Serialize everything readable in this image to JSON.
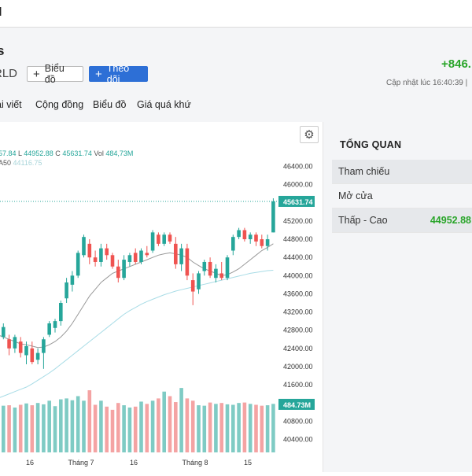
{
  "topbar": {
    "logo": "I"
  },
  "header": {
    "title": "s",
    "subtitle": "RLD",
    "chart_button": "Biểu đồ",
    "follow_button": "Theo dõi",
    "change": "+846.",
    "updated_label": "Cập nhật lúc",
    "updated_time": "16:40:39 |"
  },
  "tabs": [
    "ài viết",
    "Cộng đồng",
    "Biểu đồ",
    "Giá quá khứ"
  ],
  "sidebar": {
    "title": "TỔNG QUAN",
    "rows": [
      {
        "label": "Tham chiếu",
        "value": ""
      },
      {
        "label": "Mở cửa",
        "value": ""
      },
      {
        "label": "Thấp - Cao",
        "value": "44952.88"
      }
    ]
  },
  "chart": {
    "legend_o": "57.84",
    "legend_l_label": "L",
    "legend_l": "44952.88",
    "legend_c_label": "C",
    "legend_c": "45631.74",
    "legend_vol_label": "Vol",
    "legend_vol": "484,73M",
    "ma_label": "A50",
    "ma_value": "44116.75",
    "last_price_tag": "45631.74",
    "volume_tag": "484.73M",
    "price_ticks": [
      "46400.00",
      "46000.00",
      "45200.00",
      "44800.00",
      "44400.00",
      "44000.00",
      "43600.00",
      "43200.00",
      "42800.00",
      "42400.00",
      "42000.00",
      "41600.00",
      "41200.00",
      "40800.00",
      "40400.00"
    ],
    "x_labels": [
      "16",
      "Tháng 7",
      "16",
      "Tháng 8",
      "15"
    ],
    "colors": {
      "up": "#26a69a",
      "down": "#ef5350",
      "vol_up": "#7fcbc4",
      "vol_down": "#f4a3a3",
      "ma20": "#999999",
      "ma50": "#a8dce6"
    }
  },
  "chart_data": {
    "type": "candlestick",
    "ylim": [
      40200,
      46600
    ],
    "candles": [
      {
        "o": 42800,
        "h": 42850,
        "l": 42450,
        "c": 42650
      },
      {
        "o": 42650,
        "h": 42950,
        "l": 42600,
        "c": 42870
      },
      {
        "o": 42600,
        "h": 42700,
        "l": 42250,
        "c": 42400
      },
      {
        "o": 42400,
        "h": 42700,
        "l": 42300,
        "c": 42650
      },
      {
        "o": 42550,
        "h": 42650,
        "l": 42200,
        "c": 42300
      },
      {
        "o": 42250,
        "h": 42550,
        "l": 42050,
        "c": 42450
      },
      {
        "o": 42400,
        "h": 42550,
        "l": 42050,
        "c": 42100
      },
      {
        "o": 42150,
        "h": 42400,
        "l": 42050,
        "c": 42300
      },
      {
        "o": 42300,
        "h": 42650,
        "l": 41950,
        "c": 42600
      },
      {
        "o": 42700,
        "h": 43000,
        "l": 42650,
        "c": 42950
      },
      {
        "o": 42850,
        "h": 43050,
        "l": 42750,
        "c": 43000
      },
      {
        "o": 43000,
        "h": 43450,
        "l": 42900,
        "c": 43400
      },
      {
        "o": 43500,
        "h": 43950,
        "l": 43400,
        "c": 43850
      },
      {
        "o": 43800,
        "h": 44100,
        "l": 43650,
        "c": 44000
      },
      {
        "o": 44000,
        "h": 44550,
        "l": 43950,
        "c": 44500
      },
      {
        "o": 44450,
        "h": 44900,
        "l": 44400,
        "c": 44850
      },
      {
        "o": 44700,
        "h": 44800,
        "l": 44250,
        "c": 44400
      },
      {
        "o": 44400,
        "h": 44550,
        "l": 44200,
        "c": 44300
      },
      {
        "o": 44300,
        "h": 44700,
        "l": 44200,
        "c": 44600
      },
      {
        "o": 44600,
        "h": 44700,
        "l": 44350,
        "c": 44450
      },
      {
        "o": 44450,
        "h": 44500,
        "l": 44150,
        "c": 44200
      },
      {
        "o": 44200,
        "h": 44350,
        "l": 43850,
        "c": 43950
      },
      {
        "o": 43950,
        "h": 44450,
        "l": 43900,
        "c": 44350
      },
      {
        "o": 44300,
        "h": 44500,
        "l": 44200,
        "c": 44450
      },
      {
        "o": 44500,
        "h": 44600,
        "l": 44250,
        "c": 44300
      },
      {
        "o": 44300,
        "h": 44600,
        "l": 44250,
        "c": 44550
      },
      {
        "o": 44500,
        "h": 44650,
        "l": 44400,
        "c": 44450
      },
      {
        "o": 44550,
        "h": 45000,
        "l": 44500,
        "c": 44950
      },
      {
        "o": 44900,
        "h": 44950,
        "l": 44650,
        "c": 44700
      },
      {
        "o": 44700,
        "h": 44950,
        "l": 44650,
        "c": 44900
      },
      {
        "o": 44900,
        "h": 44950,
        "l": 44700,
        "c": 44750
      },
      {
        "o": 44700,
        "h": 44850,
        "l": 44150,
        "c": 44250
      },
      {
        "o": 44250,
        "h": 44700,
        "l": 44100,
        "c": 44600
      },
      {
        "o": 44600,
        "h": 44700,
        "l": 43900,
        "c": 44000
      },
      {
        "o": 43900,
        "h": 44050,
        "l": 43350,
        "c": 43650
      },
      {
        "o": 43700,
        "h": 44100,
        "l": 43600,
        "c": 44050
      },
      {
        "o": 44100,
        "h": 44350,
        "l": 44000,
        "c": 44300
      },
      {
        "o": 44300,
        "h": 44400,
        "l": 43950,
        "c": 44000
      },
      {
        "o": 43950,
        "h": 44250,
        "l": 43850,
        "c": 44150
      },
      {
        "o": 44050,
        "h": 44300,
        "l": 43900,
        "c": 43950
      },
      {
        "o": 43950,
        "h": 44450,
        "l": 43900,
        "c": 44400
      },
      {
        "o": 44550,
        "h": 44900,
        "l": 44450,
        "c": 44850
      },
      {
        "o": 44850,
        "h": 45050,
        "l": 44800,
        "c": 45000
      },
      {
        "o": 45000,
        "h": 45050,
        "l": 44750,
        "c": 44800
      },
      {
        "o": 44800,
        "h": 44950,
        "l": 44700,
        "c": 44900
      },
      {
        "o": 44900,
        "h": 44950,
        "l": 44650,
        "c": 44750
      },
      {
        "o": 44800,
        "h": 44900,
        "l": 44600,
        "c": 44650
      },
      {
        "o": 44650,
        "h": 44900,
        "l": 44550,
        "c": 44800
      },
      {
        "o": 44950,
        "h": 45700,
        "l": 44950,
        "c": 45632
      }
    ],
    "volume_ylim": [
      40200,
      46600
    ],
    "volume_tops": [
      41120,
      41140,
      41150,
      41100,
      41160,
      41190,
      41150,
      41200,
      41170,
      41250,
      41130,
      41280,
      41300,
      41260,
      41350,
      41250,
      41480,
      41160,
      41250,
      41120,
      41050,
      41200,
      41150,
      41100,
      41120,
      41230,
      41180,
      41250,
      41300,
      41450,
      41350,
      41220,
      41530,
      41300,
      41250,
      41150,
      41140,
      41210,
      41180,
      41200,
      41170,
      41160,
      41200,
      41210,
      41180,
      41160,
      41140,
      41150,
      41180
    ],
    "ma20": [
      42700,
      42650,
      42600,
      42550,
      42500,
      42480,
      42450,
      42420,
      42430,
      42480,
      42550,
      42650,
      42780,
      42950,
      43150,
      43350,
      43550,
      43700,
      43850,
      43950,
      44050,
      44100,
      44150,
      44200,
      44250,
      44300,
      44350,
      44400,
      44450,
      44480,
      44500,
      44480,
      44450,
      44400,
      44300,
      44220,
      44150,
      44100,
      44050,
      44000,
      44020,
      44080,
      44150,
      44250,
      44350,
      44450,
      44550,
      44620,
      44700
    ],
    "ma50": [
      41300,
      41350,
      41400,
      41450,
      41500,
      41550,
      41620,
      41700,
      41780,
      41860,
      41950,
      42050,
      42150,
      42250,
      42350,
      42450,
      42550,
      42650,
      42750,
      42850,
      42950,
      43050,
      43150,
      43230,
      43300,
      43370,
      43430,
      43480,
      43530,
      43580,
      43620,
      43660,
      43690,
      43720,
      43750,
      43780,
      43810,
      43840,
      43870,
      43900,
      43930,
      43960,
      43990,
      44020,
      44050,
      44070,
      44090,
      44110,
      44117
    ]
  }
}
